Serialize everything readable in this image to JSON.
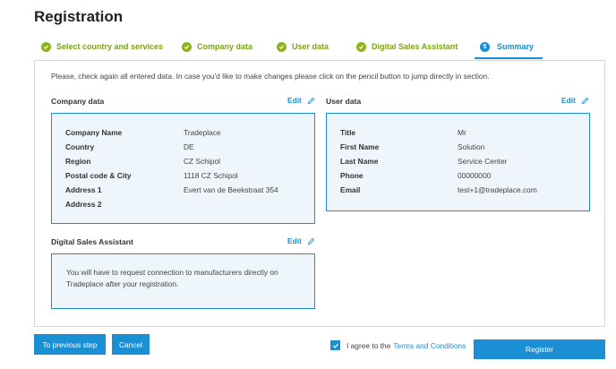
{
  "page": {
    "title": "Registration"
  },
  "steps": [
    {
      "label": "Select country and services",
      "state": "done"
    },
    {
      "label": "Company data",
      "state": "done"
    },
    {
      "label": "User data",
      "state": "done"
    },
    {
      "label": "Digital Sales Assistant",
      "state": "done"
    },
    {
      "label": "Summary",
      "state": "active",
      "number": "5"
    }
  ],
  "intro": "Please, check again all entered data. In case you'd like to make changes please click on the pencil button to jump directly in section.",
  "company": {
    "title": "Company data",
    "edit": "Edit",
    "fields": [
      {
        "label": "Company Name",
        "value": "Tradeplace"
      },
      {
        "label": "Country",
        "value": "DE"
      },
      {
        "label": "Region",
        "value": "CZ Schipol"
      },
      {
        "label": "Postal code & City",
        "value": "1118 CZ Schipol"
      },
      {
        "label": "Address 1",
        "value": "Evert van de Beekstraat 354"
      },
      {
        "label": "Address 2",
        "value": ""
      }
    ]
  },
  "user": {
    "title": "User data",
    "edit": "Edit",
    "fields": [
      {
        "label": "Title",
        "value": "Mr"
      },
      {
        "label": "First Name",
        "value": "Solution"
      },
      {
        "label": "Last Name",
        "value": "Service Center"
      },
      {
        "label": "Phone",
        "value": "00000000"
      },
      {
        "label": "Email",
        "value": "test+1@tradeplace.com"
      }
    ]
  },
  "dsa": {
    "title": "Digital Sales Assistant",
    "edit": "Edit",
    "text": "You will have to request connection to manufacturers directly on Tradeplace after your registration."
  },
  "footer": {
    "prev_label": "To previous step",
    "cancel_label": "Cancel",
    "agree_text": "I agree to the",
    "terms_link": "Terms and Conditions",
    "register_label": "Register"
  },
  "colors": {
    "accent": "#1a8fd4",
    "done": "#8bb51a"
  },
  "icons": {
    "done": "check-icon",
    "edit": "pencil-icon",
    "agree": "checkbox-checked-icon"
  }
}
